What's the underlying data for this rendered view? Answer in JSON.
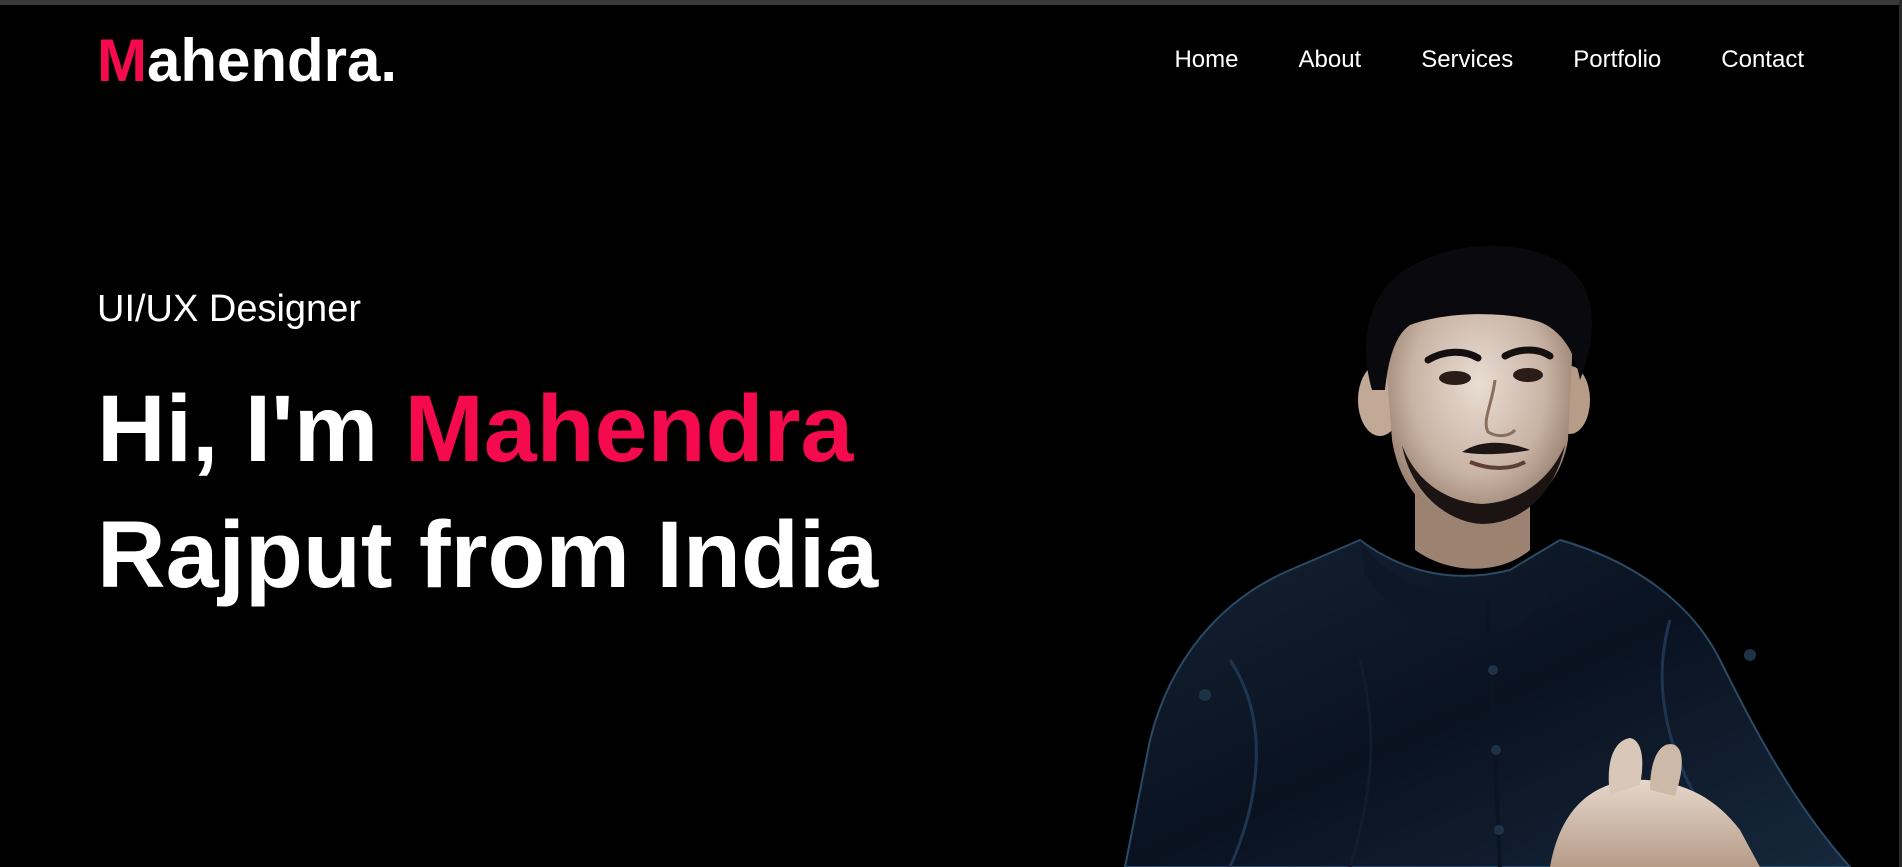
{
  "header": {
    "logo_first": "M",
    "logo_rest": "ahendra.",
    "nav": [
      {
        "label": "Home"
      },
      {
        "label": "About"
      },
      {
        "label": "Services"
      },
      {
        "label": "Portfolio"
      },
      {
        "label": "Contact"
      }
    ]
  },
  "hero": {
    "subtitle": "UI/UX Designer",
    "greeting": "Hi, I'm ",
    "name_highlight": "Mahendra",
    "line2": "Rajput from India"
  },
  "colors": {
    "background": "#000000",
    "accent": "#f50a4e",
    "text": "#ffffff"
  },
  "icons": {
    "portrait": "person-portrait"
  }
}
